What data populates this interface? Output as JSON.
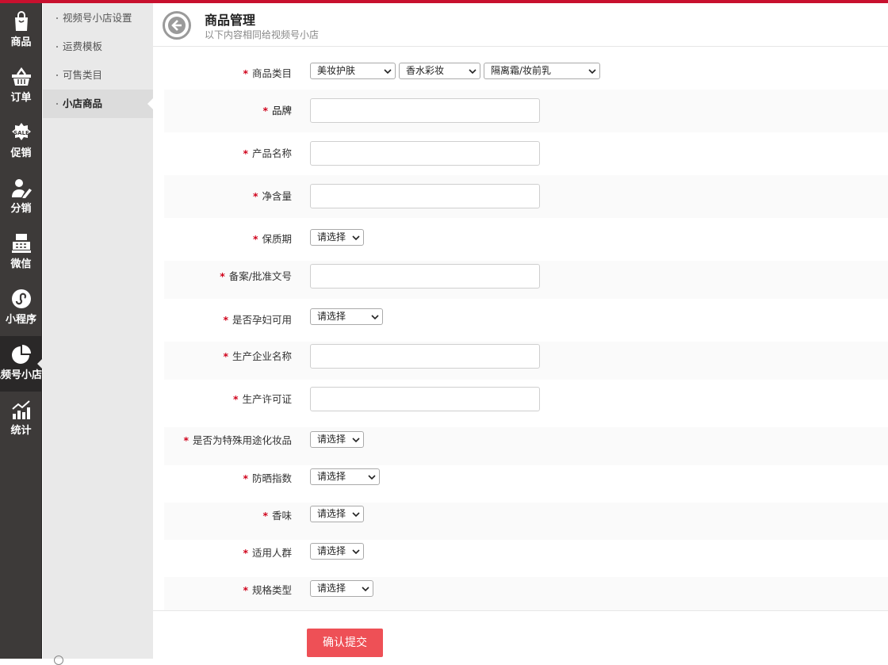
{
  "left_nav": [
    {
      "label": "商品",
      "icon": "shopping-bag-icon"
    },
    {
      "label": "订单",
      "icon": "basket-icon"
    },
    {
      "label": "促销",
      "icon": "sale-badge-icon"
    },
    {
      "label": "分销",
      "icon": "user-pen-icon"
    },
    {
      "label": "微信",
      "icon": "cash-register-icon"
    },
    {
      "label": "小程序",
      "icon": "mini-program-icon"
    },
    {
      "label": "视频号小店",
      "icon": "pie-chart-icon"
    },
    {
      "label": "统计",
      "icon": "bar-chart-icon"
    }
  ],
  "sub_nav": [
    {
      "label": "视频号小店设置"
    },
    {
      "label": "运费模板"
    },
    {
      "label": "可售类目"
    },
    {
      "label": "小店商品"
    }
  ],
  "header": {
    "title": "商品管理",
    "subtitle": "以下内容相同给视频号小店"
  },
  "form": {
    "category": {
      "label": "商品类目",
      "values": [
        "美妆护肤",
        "香水彩妆",
        "隔离霜/妆前乳"
      ]
    },
    "brand": {
      "label": "品牌"
    },
    "product_name": {
      "label": "产品名称"
    },
    "net_content": {
      "label": "净含量"
    },
    "shelf_life": {
      "label": "保质期",
      "value": "请选择"
    },
    "approval_no": {
      "label": "备案/批准文号"
    },
    "pregnant": {
      "label": "是否孕妇可用",
      "value": "请选择"
    },
    "manufacturer": {
      "label": "生产企业名称"
    },
    "license": {
      "label": "生产许可证"
    },
    "special_use": {
      "label": "是否为特殊用途化妆品",
      "value": "请选择"
    },
    "spf": {
      "label": "防晒指数",
      "value": "请选择"
    },
    "fragrance": {
      "label": "香味",
      "value": "请选择"
    },
    "target_group": {
      "label": "适用人群",
      "value": "请选择"
    },
    "spec_type": {
      "label": "规格类型",
      "value": "请选择"
    },
    "required_mark": "*",
    "submit_label": "确认提交"
  },
  "colors": {
    "accent_red": "#c8102e",
    "submit": "#ee5056",
    "required": "#d0021b",
    "sidebar": "#3d3a39"
  }
}
